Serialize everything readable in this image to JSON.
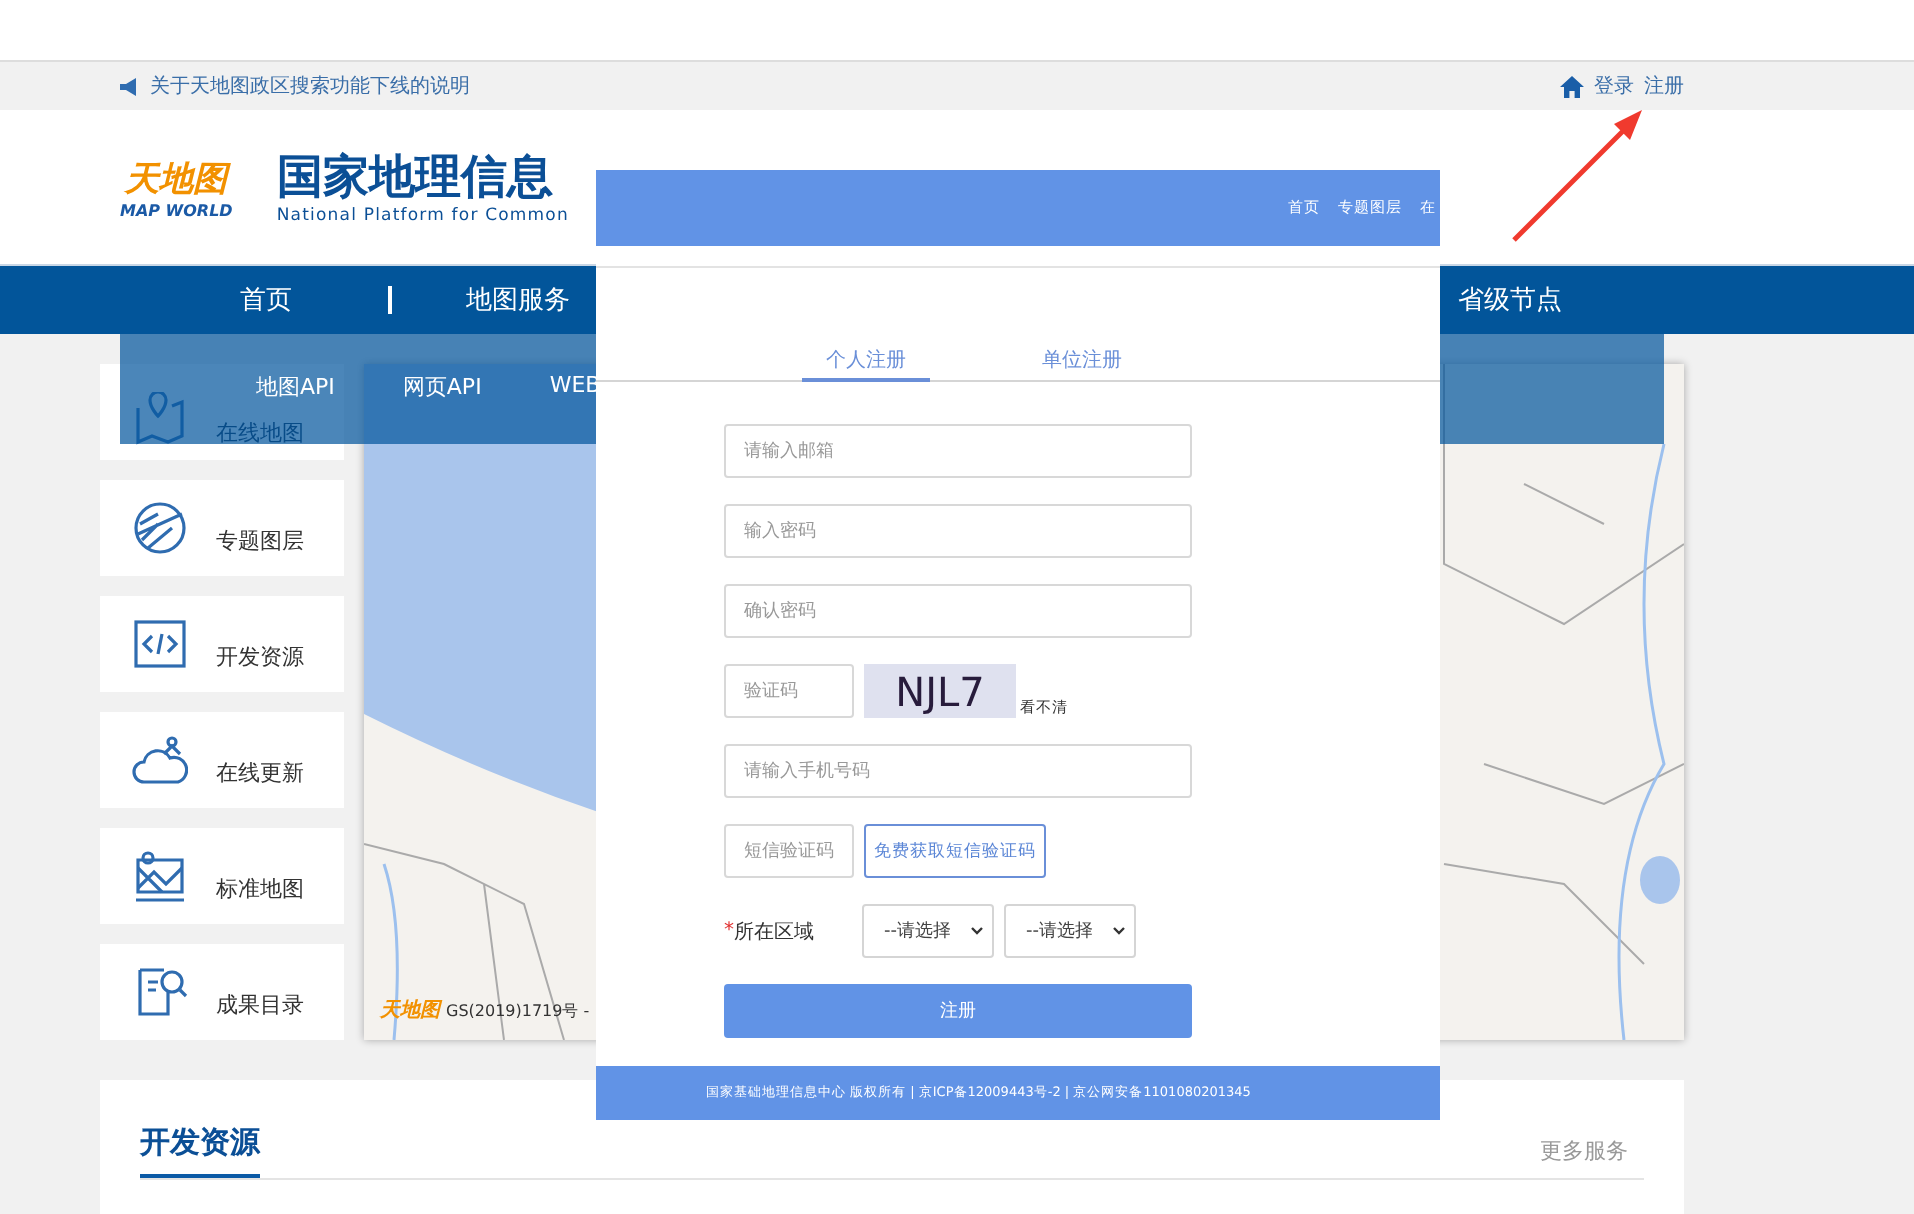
{
  "notice_bar": {
    "notice": "关于天地图政区搜索功能下线的说明",
    "links": [
      {
        "label": "登录"
      },
      {
        "label": "注册"
      }
    ]
  },
  "header": {
    "logo_text": "天地图",
    "logo_subtext": "MAP WORLD",
    "title": "国家地理信息",
    "subtitle": "National Platform for Common"
  },
  "nav": {
    "items": [
      {
        "label": "首页"
      },
      {
        "label": "地图服务"
      },
      {
        "label": "省级节点"
      }
    ]
  },
  "submenu": {
    "items": [
      "地图API",
      "网页API",
      "WEB"
    ]
  },
  "sidebar": {
    "items": [
      {
        "label": "在线地图",
        "kind": "map"
      },
      {
        "label": "专题图层",
        "kind": "layers"
      },
      {
        "label": "开发资源",
        "kind": "code"
      },
      {
        "label": "在线更新",
        "kind": "cloud"
      },
      {
        "label": "标准地图",
        "kind": "standard"
      },
      {
        "label": "成果目录",
        "kind": "catalog"
      }
    ]
  },
  "map": {
    "logo": "天地图",
    "attribution": "GS(2019)1719号 -"
  },
  "section": {
    "title": "开发资源",
    "more": "更多服务"
  },
  "register_dialog": {
    "header_links": [
      "首页",
      "专题图层",
      "在"
    ],
    "tabs": [
      {
        "label": "个人注册",
        "selected": true
      },
      {
        "label": "单位注册",
        "selected": false
      }
    ],
    "fields": [
      {
        "kind": "text",
        "placeholder": "请输入邮箱"
      },
      {
        "kind": "text",
        "placeholder": "输入密码"
      },
      {
        "kind": "text",
        "placeholder": "确认密码"
      },
      {
        "kind": "captcha",
        "placeholder": "验证码",
        "code": "NJL7",
        "refresh": "看不清"
      },
      {
        "kind": "text",
        "placeholder": "请输入手机号码"
      },
      {
        "kind": "sms",
        "placeholder": "短信验证码",
        "button": "免费获取短信验证码"
      },
      {
        "kind": "region",
        "required_mark": "*",
        "label": "所在区域",
        "selects": [
          "--请选择",
          "--请选择"
        ]
      }
    ],
    "submit": "注册",
    "footer": "国家基础地理信息中心 版权所有 | 京ICP备12009443号-2 | 京公网安备1101080201345"
  }
}
